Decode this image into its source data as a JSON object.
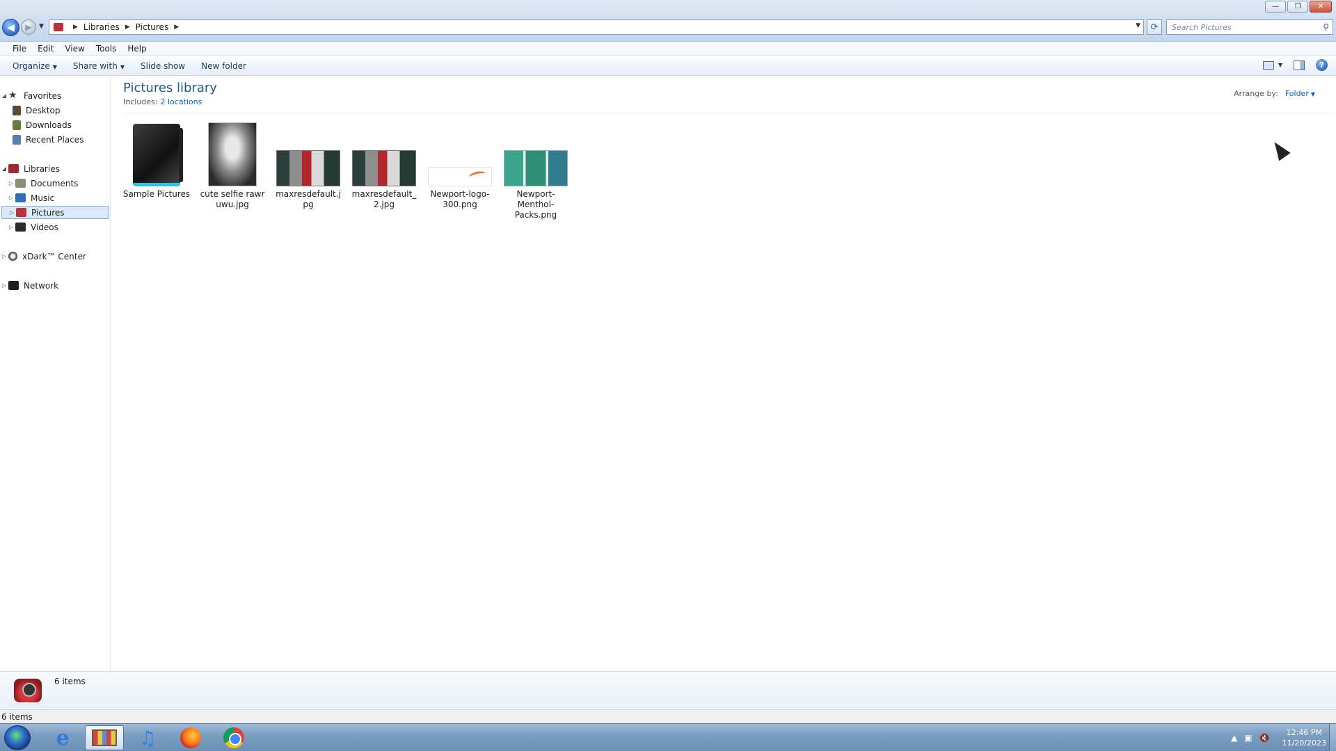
{
  "window": {
    "controls": {
      "minimize": "—",
      "maximize": "❐",
      "close": "✕"
    }
  },
  "address": {
    "crumbs": [
      "Libraries",
      "Pictures"
    ],
    "search_placeholder": "Search Pictures"
  },
  "menubar": {
    "items": [
      "File",
      "Edit",
      "View",
      "Tools",
      "Help"
    ]
  },
  "toolbar": {
    "organize": "Organize",
    "share_with": "Share with",
    "slide_show": "Slide show",
    "new_folder": "New folder"
  },
  "navigation": {
    "favorites": {
      "label": "Favorites",
      "items": [
        "Desktop",
        "Downloads",
        "Recent Places"
      ]
    },
    "libraries": {
      "label": "Libraries",
      "items": [
        "Documents",
        "Music",
        "Pictures",
        "Videos"
      ],
      "selected": "Pictures"
    },
    "xdark": "xDark™ Center",
    "network": "Network"
  },
  "library": {
    "title": "Pictures library",
    "includes_label": "Includes:",
    "includes_link": "2 locations",
    "arrange_label": "Arrange by:",
    "arrange_value": "Folder"
  },
  "files": [
    {
      "name": "Sample Pictures",
      "icon": "folder-icon"
    },
    {
      "name": "cute selfie rawr uwu.jpg",
      "icon": "photo-thumbnail"
    },
    {
      "name": "maxresdefault.jpg",
      "icon": "photo-thumbnail"
    },
    {
      "name": "maxresdefault_2.jpg",
      "icon": "photo-thumbnail"
    },
    {
      "name": "Newport-logo-300.png",
      "icon": "photo-thumbnail"
    },
    {
      "name": "Newport-Menthol-Packs.png",
      "icon": "photo-thumbnail"
    }
  ],
  "details": {
    "count": "6 items"
  },
  "status": {
    "count": "6 items"
  },
  "taskbar": {
    "apps": [
      "internet-explorer",
      "windows-explorer",
      "itunes",
      "firefox",
      "chrome"
    ],
    "active": "windows-explorer"
  },
  "clock": {
    "time": "12:46 PM",
    "date": "11/20/2023"
  },
  "colors": {
    "library_title": "#1e5b8b",
    "link": "#0a5fb4",
    "selection": "#dbe9f9"
  }
}
